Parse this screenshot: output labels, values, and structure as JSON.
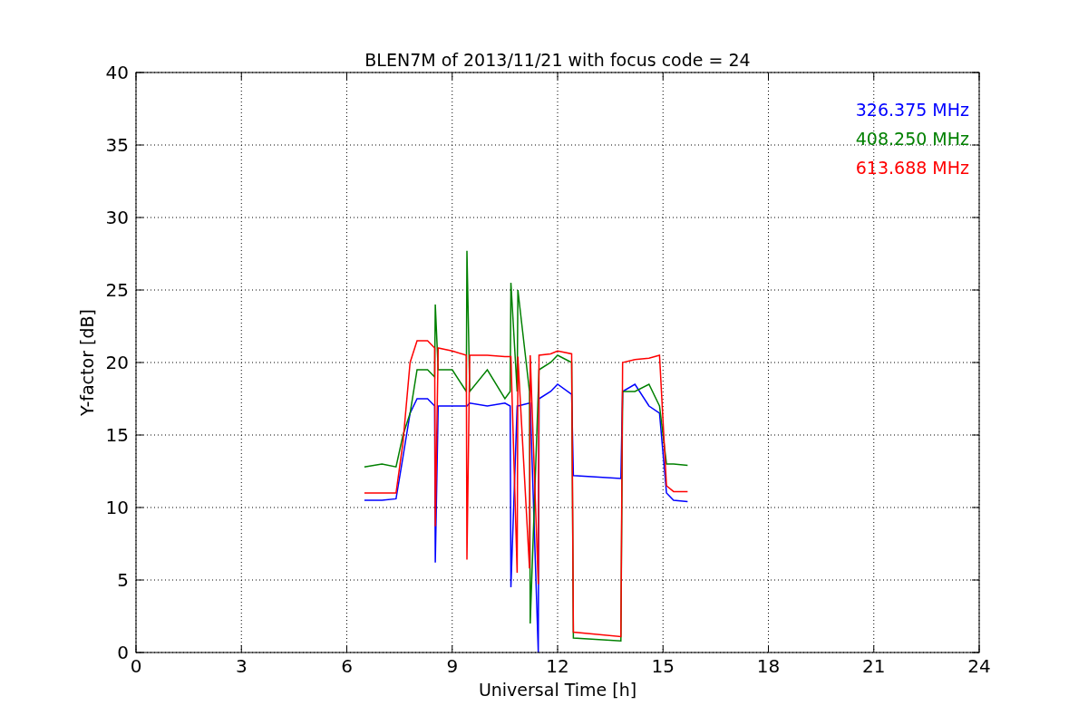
{
  "chart_data": {
    "type": "line",
    "title": "BLEN7M of 2013/11/21 with focus code = 24",
    "xlabel": "Universal Time [h]",
    "ylabel": "Y-factor [dB]",
    "x": [
      6.5,
      7.0,
      7.4,
      7.6,
      7.8,
      8.0,
      8.3,
      8.5,
      8.52,
      8.6,
      9.0,
      9.4,
      9.42,
      9.5,
      10.0,
      10.5,
      10.65,
      10.67,
      10.85,
      10.87,
      11.2,
      11.22,
      11.45,
      11.47,
      11.8,
      12.0,
      12.4,
      12.45,
      13.8,
      13.85,
      14.2,
      14.6,
      14.9,
      15.1,
      15.3,
      15.7
    ],
    "series": [
      {
        "name": "326.375 MHz",
        "color": "#0000ff",
        "values": [
          10.5,
          10.5,
          10.6,
          13.5,
          16.5,
          17.5,
          17.5,
          17.0,
          6.2,
          17.0,
          17.0,
          17.0,
          17.0,
          17.2,
          17.0,
          17.2,
          17.0,
          4.5,
          17.0,
          17.0,
          17.2,
          17.2,
          0.0,
          17.5,
          18.0,
          18.5,
          17.8,
          12.2,
          12.0,
          18.0,
          18.5,
          17.0,
          16.5,
          11.0,
          10.5,
          10.4
        ]
      },
      {
        "name": "408.250 MHz",
        "color": "#008000",
        "values": [
          12.8,
          13.0,
          12.8,
          15.0,
          16.5,
          19.5,
          19.5,
          19.0,
          24.0,
          19.5,
          19.5,
          18.0,
          27.7,
          18.0,
          19.5,
          17.5,
          18.0,
          25.5,
          18.0,
          25.0,
          18.0,
          2.0,
          18.0,
          19.5,
          20.0,
          20.5,
          20.0,
          1.0,
          0.8,
          18.0,
          18.0,
          18.5,
          17.0,
          13.0,
          13.0,
          12.9
        ]
      },
      {
        "name": "613.688 MHz",
        "color": "#ff0000",
        "values": [
          11.0,
          11.0,
          11.0,
          14.5,
          20.0,
          21.5,
          21.5,
          21.0,
          8.7,
          21.0,
          20.8,
          20.5,
          6.4,
          20.5,
          20.5,
          20.4,
          20.4,
          20.4,
          5.5,
          20.4,
          5.8,
          20.5,
          4.7,
          20.5,
          20.6,
          20.8,
          20.6,
          1.4,
          1.1,
          20.0,
          20.2,
          20.3,
          20.5,
          11.5,
          11.1,
          11.1
        ]
      }
    ],
    "grid": true,
    "xlim": [
      0,
      24
    ],
    "ylim": [
      0,
      40
    ],
    "xticks": [
      0,
      3,
      6,
      9,
      12,
      15,
      18,
      21,
      24
    ],
    "yticks": [
      0,
      5,
      10,
      15,
      20,
      25,
      30,
      35,
      40
    ]
  }
}
